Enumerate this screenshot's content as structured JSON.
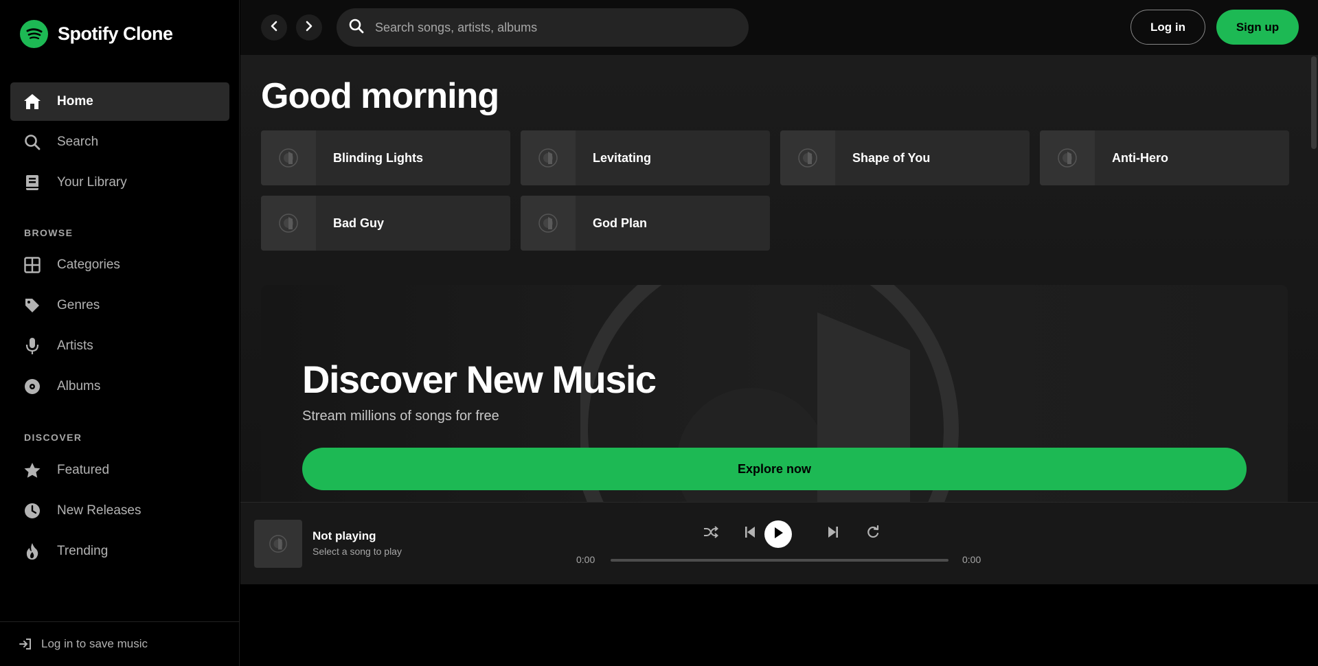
{
  "brand": {
    "name": "Spotify Clone",
    "logo_icon": "spotify-logo-icon",
    "accent": "#1db954"
  },
  "sidebar": {
    "primary": [
      {
        "label": "Home",
        "icon": "home-icon",
        "active": true
      },
      {
        "label": "Search",
        "icon": "search-icon",
        "active": false
      },
      {
        "label": "Your Library",
        "icon": "library-icon",
        "active": false
      }
    ],
    "browse_label": "BROWSE",
    "browse": [
      {
        "label": "Categories",
        "icon": "grid-icon"
      },
      {
        "label": "Genres",
        "icon": "tag-icon"
      },
      {
        "label": "Artists",
        "icon": "microphone-icon"
      },
      {
        "label": "Albums",
        "icon": "disc-icon"
      }
    ],
    "discover_label": "DISCOVER",
    "discover": [
      {
        "label": "Featured",
        "icon": "star-icon"
      },
      {
        "label": "New Releases",
        "icon": "clock-icon"
      },
      {
        "label": "Trending",
        "icon": "fire-icon"
      }
    ],
    "footer": {
      "label": "Log in to save music",
      "icon": "sign-in-icon"
    }
  },
  "topbar": {
    "search_placeholder": "Search songs, artists, albums",
    "login_label": "Log in",
    "signup_label": "Sign up"
  },
  "main": {
    "greeting": "Good morning",
    "quick_picks": [
      {
        "title": "Blinding Lights"
      },
      {
        "title": "Levitating"
      },
      {
        "title": "Shape of You"
      },
      {
        "title": "Anti-Hero"
      },
      {
        "title": "Bad Guy"
      },
      {
        "title": "God Plan"
      }
    ],
    "hero": {
      "title": "Discover New Music",
      "subtitle": "Stream millions of songs for free",
      "cta": "Explore now"
    }
  },
  "player": {
    "title": "Not playing",
    "subtitle": "Select a song to play",
    "elapsed": "0:00",
    "duration": "0:00",
    "progress": 0
  }
}
